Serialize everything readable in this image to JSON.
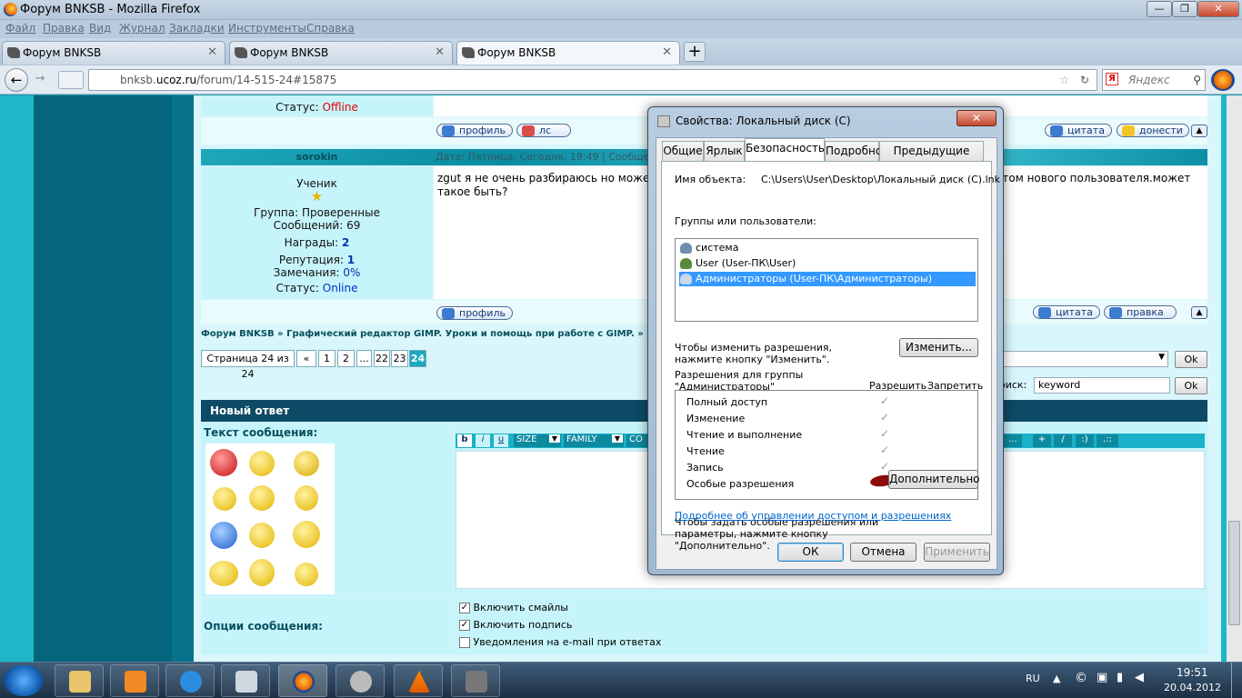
{
  "browser": {
    "window_title": "Форум BNKSB - Mozilla Firefox",
    "menu": [
      "Файл",
      "Правка",
      "Вид",
      "Журнал",
      "Закладки",
      "Инструменты",
      "Справка"
    ],
    "tabs": [
      {
        "label": "Форум BNKSB"
      },
      {
        "label": "Форум BNKSB"
      },
      {
        "label": "Форум BNKSB"
      }
    ],
    "url_domain": "bnksb.",
    "url_host": "ucoz.ru",
    "url_path": "/forum/14-515-24#15875",
    "search_placeholder": "Яндекс",
    "search_engine_icon": "Я"
  },
  "forum": {
    "post1": {
      "status_label": "Статус:",
      "status_value": "Offline"
    },
    "post1_buttons": {
      "profile": "профиль",
      "pm": "лс",
      "quote": "цитата",
      "report": "донести"
    },
    "post2": {
      "author": "sorokin",
      "date": "Дата: Пятница, Сегодня, 19:49 | Сообщение",
      "rank": "Ученик",
      "group": "Группа: Проверенные",
      "messages": "Сообщений: 69",
      "awards_label": "Награды:",
      "awards_value": "2",
      "reputation_label": "Репутация:",
      "reputation_value": "1",
      "warnings_label": "Замечания:",
      "warnings_value": "0%",
      "status_label": "Статус:",
      "status_value": "Online",
      "text": "zgut я не очень разбираюсь но может",
      "text2": "такое быть?",
      "text_right": "етом нового пользователя.может"
    },
    "post2_buttons": {
      "profile": "профиль",
      "quote": "цитата",
      "edit": "правка"
    },
    "breadcrumb": "Форум BNKSB » Графический редактор GIMP. Уроки и помощь при работе с GIMP. » Уроки GIM",
    "pagination": {
      "label": "Страница 24 из 24",
      "items": [
        "«",
        "1",
        "2",
        "...",
        "22",
        "23",
        "24"
      ]
    },
    "ok_label": "Ok",
    "search_label": "оиск:",
    "search_value": "keyword",
    "reply_header": "Новый ответ",
    "message_text_label": "Текст сообщения:",
    "editor_buttons": [
      "b",
      "i",
      "u",
      "SIZE",
      "FAMILY",
      "CO"
    ],
    "editor_buttons_right": [
      "...",
      "+",
      "/",
      ":)",
      ".::"
    ],
    "options_label": "Опции сообщения:",
    "options": [
      {
        "label": "Включить смайлы",
        "checked": true
      },
      {
        "label": "Включить подпись",
        "checked": true
      },
      {
        "label": "Уведомления на e-mail при ответах",
        "checked": false
      }
    ]
  },
  "dialog": {
    "title": "Свойства: Локальный диск (C)",
    "tabs": [
      "Общие",
      "Ярлык",
      "Безопасность",
      "Подробно",
      "Предыдущие версии"
    ],
    "object_label": "Имя объекта:",
    "object_value": "C:\\Users\\User\\Desktop\\Локальный диск (C).lnk",
    "groups_label": "Группы или пользователи:",
    "groups": [
      "система",
      "User (User-ПК\\User)",
      "Администраторы (User-ПК\\Администраторы)"
    ],
    "change_hint_1": "Чтобы изменить разрешения,",
    "change_hint_2": "нажмите кнопку \"Изменить\".",
    "change_button": "Изменить...",
    "perm_label_1": "Разрешения для группы",
    "perm_label_2": "\"Администраторы\"",
    "allow_label": "Разрешить",
    "deny_label": "Запретить",
    "permissions": [
      "Полный доступ",
      "Изменение",
      "Чтение и выполнение",
      "Чтение",
      "Запись",
      "Особые разрешения"
    ],
    "check_mark": "✓",
    "advanced_hint_1": "Чтобы задать особые разрешения или",
    "advanced_hint_2": "параметры, нажмите кнопку",
    "advanced_hint_3": "\"Дополнительно\".",
    "advanced_button": "Дополнительно",
    "link": "Подробнее об управлении доступом и разрешениях",
    "ok": "ОК",
    "cancel": "Отмена",
    "apply": "Применить"
  },
  "taskbar": {
    "lang": "RU",
    "time": "19:51",
    "date": "20.04.2012"
  },
  "colors": {
    "offline": "#e00000",
    "online": "#0033cc",
    "page_bg": "#1eb7c8",
    "dialog_select": "#3399ff"
  }
}
